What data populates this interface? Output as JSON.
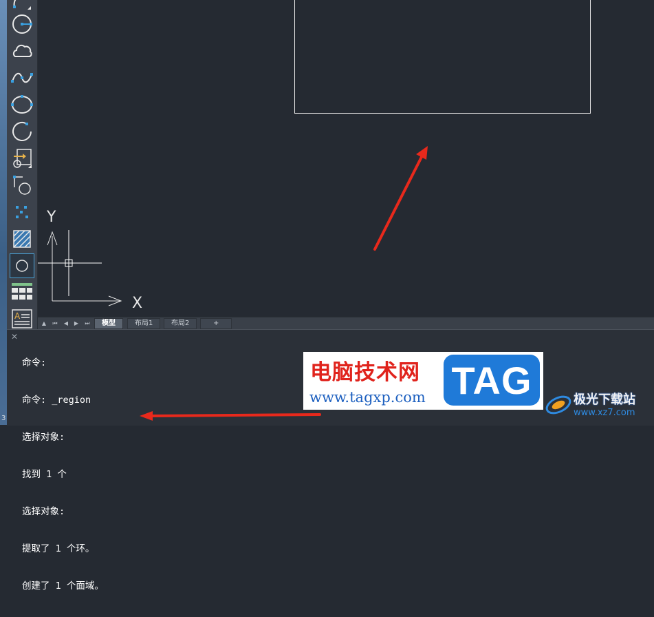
{
  "toolbar": {
    "tools": [
      {
        "name": "arc-icon"
      },
      {
        "name": "circle-icon"
      },
      {
        "name": "revision-cloud-icon"
      },
      {
        "name": "spline-icon"
      },
      {
        "name": "ellipse-icon"
      },
      {
        "name": "elliptical-arc-icon"
      },
      {
        "name": "insert-block-icon"
      },
      {
        "name": "create-block-icon"
      },
      {
        "name": "point-icon"
      },
      {
        "name": "hatch-icon"
      },
      {
        "name": "region-icon",
        "active": true
      },
      {
        "name": "table-icon"
      },
      {
        "name": "multiline-text-icon"
      }
    ]
  },
  "ucs": {
    "y_label": "Y",
    "x_label": "X"
  },
  "tabs": {
    "items": [
      {
        "label": "模型",
        "active": true
      },
      {
        "label": "布局1",
        "active": false
      },
      {
        "label": "布局2",
        "active": false
      }
    ],
    "add_label": "+"
  },
  "command": {
    "close_glyph": "✕",
    "lines": [
      "命令:",
      "命令: _region",
      "选择对象:",
      "找到 1 个",
      "选择对象:",
      "提取了 1 个环。",
      "创建了 1 个面域。"
    ]
  },
  "status": {
    "left_number": "3"
  },
  "watermark": {
    "site_cn": "电脑技术网",
    "site_url": "www.tagxp.com",
    "tag_text": "TAG",
    "brand2_cn": "极光下载站",
    "brand2_url": "www.xz7.com"
  },
  "colors": {
    "canvas_bg": "#252a32",
    "toolbar_bg": "#3c424c",
    "accent_blue": "#4aa3d8",
    "arrow_red": "#e8291c",
    "tag_blue": "#1f7ad8"
  }
}
